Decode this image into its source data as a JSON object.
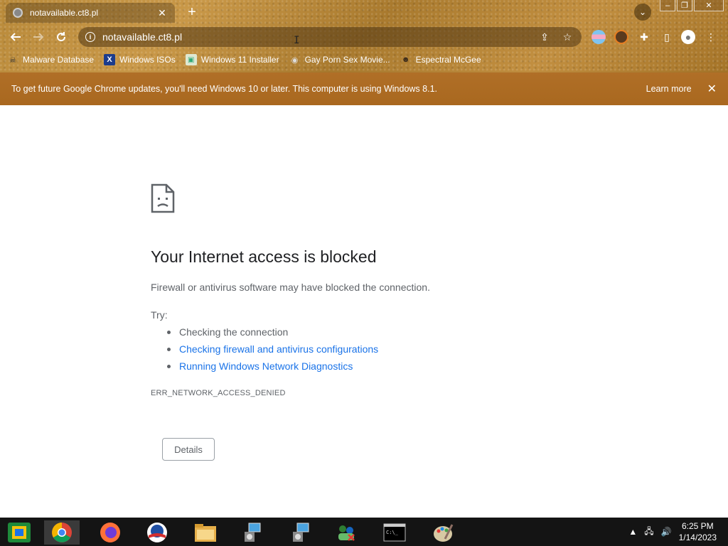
{
  "tab": {
    "title": "notavailable.ct8.pl",
    "close": "✕"
  },
  "newtab": "+",
  "window": {
    "minimize": "–",
    "maximize": "❐",
    "close": "✕"
  },
  "omnibox": {
    "url": "notavailable.ct8.pl",
    "info": "i"
  },
  "bookmarks": [
    {
      "label": "Malware Database",
      "icon": "skull-icon"
    },
    {
      "label": "Windows ISOs",
      "icon": "x-logo-icon"
    },
    {
      "label": "Windows 11 Installer",
      "icon": "image-icon"
    },
    {
      "label": "Gay Porn Sex Movie...",
      "icon": "disc-icon"
    },
    {
      "label": "Espectral McGee",
      "icon": "face-icon"
    }
  ],
  "infobar": {
    "message": "To get future Google Chrome updates, you'll need Windows 10 or later. This computer is using Windows 8.1.",
    "learn_more": "Learn more",
    "close": "✕"
  },
  "error": {
    "title": "Your Internet access is blocked",
    "description": "Firewall or antivirus software may have blocked the connection.",
    "try_label": "Try:",
    "suggestions": [
      {
        "text": "Checking the connection",
        "link": false
      },
      {
        "text": "Checking firewall and antivirus configurations",
        "link": true
      },
      {
        "text": "Running Windows Network Diagnostics",
        "link": true
      }
    ],
    "code": "ERR_NETWORK_ACCESS_DENIED",
    "details_button": "Details"
  },
  "taskbar": {
    "apps": [
      "start-icon",
      "chrome-icon",
      "firefox-icon",
      "obama-logo-icon",
      "file-explorer-icon",
      "installer-icon",
      "installer-icon-2",
      "network-users-icon",
      "command-prompt-icon",
      "paint-icon"
    ]
  },
  "clock": {
    "time": "6:25 PM",
    "date": "1/14/2023"
  },
  "colors": {
    "chrome_bg": "#b98a3a",
    "infobar_bg": "#b06f27",
    "link": "#1a73e8",
    "text": "#202124",
    "muted": "#5f6368"
  }
}
